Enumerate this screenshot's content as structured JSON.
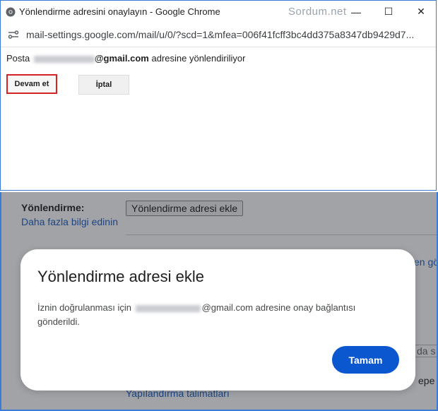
{
  "popup": {
    "window_title": "Yönlendirme adresini onaylayın - Google Chrome",
    "watermark": "Sordum.net",
    "url": "mail-settings.google.com/mail/u/0/?scd=1&mfea=006f41fcff3bc4dd375a8347db9429d7...",
    "forward_prefix": "Posta",
    "forward_email_domain": "@gmail.com",
    "forward_suffix": "adresine yönlendiriliyor",
    "continue_label": "Devam et",
    "cancel_label": "İptal",
    "window_controls": {
      "minimize": "—",
      "maximize": "☐",
      "close": "✕"
    }
  },
  "settings": {
    "forwarding_label": "Yönlendirme:",
    "learn_more": "Daha fazla bilgi edinin",
    "add_address_button": "Yönlendirme adresi ekle",
    "partial_link": "en gö",
    "partial_text_1": "da s",
    "partial_text_2": "epe M",
    "config_link": "Yapılandırma talimatları"
  },
  "dialog": {
    "title": "Yönlendirme adresi ekle",
    "text_before": "İznin doğrulanması için",
    "text_after": "@gmail.com adresine onay bağlantısı gönderildi.",
    "ok_label": "Tamam"
  },
  "colors": {
    "accent": "#0b57d0",
    "link": "#1a5fc4",
    "highlight_border": "#d52222"
  }
}
